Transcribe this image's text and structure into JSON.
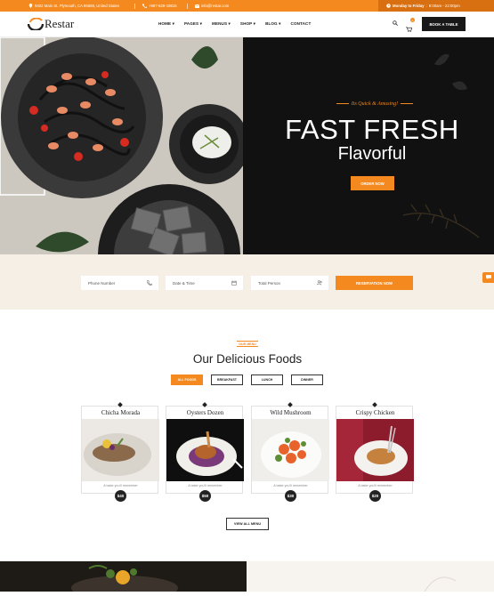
{
  "topbar": {
    "address": "9402 Main St. Plymouth, CA 95669, United States",
    "phone": "+987-629-19815",
    "email": "info@restar.com",
    "hours_label": "Monday to Friday",
    "hours_time": "9:00am - 22:00pm"
  },
  "nav": {
    "logo": "Restar",
    "items": [
      "HOME",
      "PAGES",
      "MENUS",
      "SHOP",
      "BLOG",
      "CONTACT"
    ],
    "cart_count": "0",
    "book_label": "BOOK A TABLE"
  },
  "hero": {
    "tagline": "Its Quick & Amusing!",
    "title": "FAST FRESH",
    "subtitle": "Flavorful",
    "order_label": "ORDER NOW"
  },
  "reservation": {
    "phone_placeholder": "Phone Number",
    "date_placeholder": "Date & Time",
    "person_placeholder": "Total Person",
    "submit_label": "RESERVATION NOW"
  },
  "menu": {
    "eyebrow": "OUR MENU",
    "title": "Our Delicious Foods",
    "filters": [
      "ALL FOODS",
      "BREAKFAST",
      "LUNCH",
      "DINNER"
    ],
    "items": [
      {
        "name": "Chicha Morada",
        "desc": "A taste you'll remember",
        "price": "$40"
      },
      {
        "name": "Oysters Dozen",
        "desc": "A taste you'll remember",
        "price": "$50"
      },
      {
        "name": "Wild Mushroom",
        "desc": "A taste you'll remember",
        "price": "$30"
      },
      {
        "name": "Crispy Chicken",
        "desc": "A taste you'll remember",
        "price": "$20"
      }
    ],
    "view_all": "VIEW ALL MENU"
  },
  "colors": {
    "accent": "#f4891f",
    "dark": "#181818",
    "cream": "#f6efe5"
  }
}
